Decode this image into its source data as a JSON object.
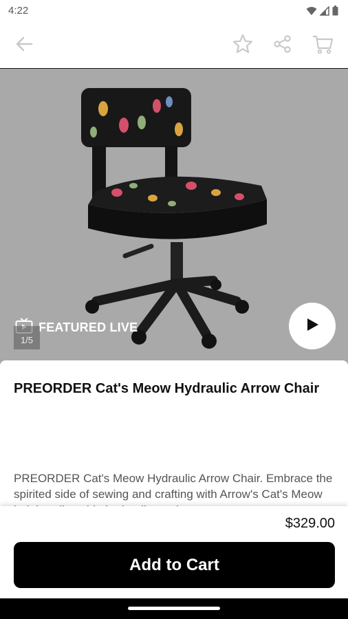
{
  "status_bar": {
    "time": "4:22",
    "icons": [
      "wifi-icon",
      "signal-icon",
      "battery-icon"
    ]
  },
  "app_bar": {
    "icons": [
      "back-arrow-icon",
      "star-icon",
      "share-icon",
      "cart-icon"
    ]
  },
  "media": {
    "featured_label": "FEATURED LIVE",
    "image_counter": "1/5",
    "background_color": "#a9a9a9"
  },
  "product": {
    "title": "PREORDER Cat's Meow Hydraulic Arrow Chair",
    "description": "PREORDER Cat's Meow Hydraulic Arrow Chair. Embrace the spirited side of sewing and crafting with Arrow's Cat's Meow height adjustable hydraulic sewing",
    "price": "$329.00"
  },
  "cart": {
    "button_label": "Add to Cart"
  },
  "colors": {
    "accent": "#000000",
    "text": "#111111"
  }
}
